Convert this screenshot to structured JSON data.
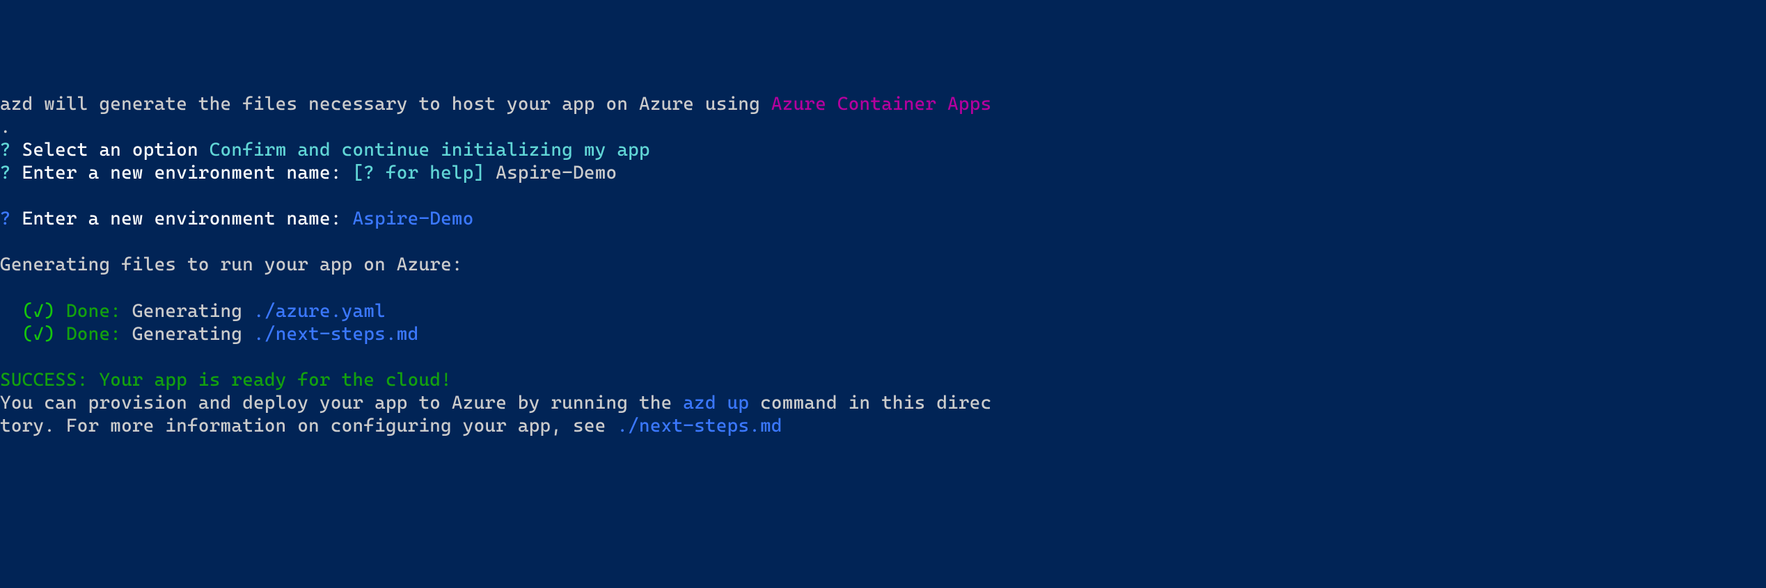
{
  "line1": {
    "text1": "azd will generate the files necessary to host your app on Azure using ",
    "linkText": "Azure Container Apps"
  },
  "dotLine": ".",
  "selectOption": {
    "q": "?",
    "prompt": " Select an option ",
    "answer": "Confirm and continue initializing my app"
  },
  "envName1": {
    "q": "?",
    "prompt": " Enter a new environment name: ",
    "help": "[? for help] ",
    "value": "Aspire-Demo"
  },
  "envName2": {
    "q": "?",
    "prompt": " Enter a new environment name: ",
    "value": "Aspire-Demo"
  },
  "generatingHeader": "Generating files to run your app on Azure:",
  "done1": {
    "indent": "  ",
    "check": "(✓) ",
    "done": "Done:",
    "action": " Generating ",
    "file": "./azure.yaml"
  },
  "done2": {
    "indent": "  ",
    "check": "(✓) ",
    "done": "Done:",
    "action": " Generating ",
    "file": "./next-steps.md"
  },
  "success": "SUCCESS: Your app is ready for the cloud!",
  "footer": {
    "text1": "You can provision and deploy your app to Azure by running the ",
    "cmd": "azd up",
    "text2": " command in this direc",
    "text3": "tory. For more information on configuring your app, see ",
    "file": "./next-steps.md"
  }
}
